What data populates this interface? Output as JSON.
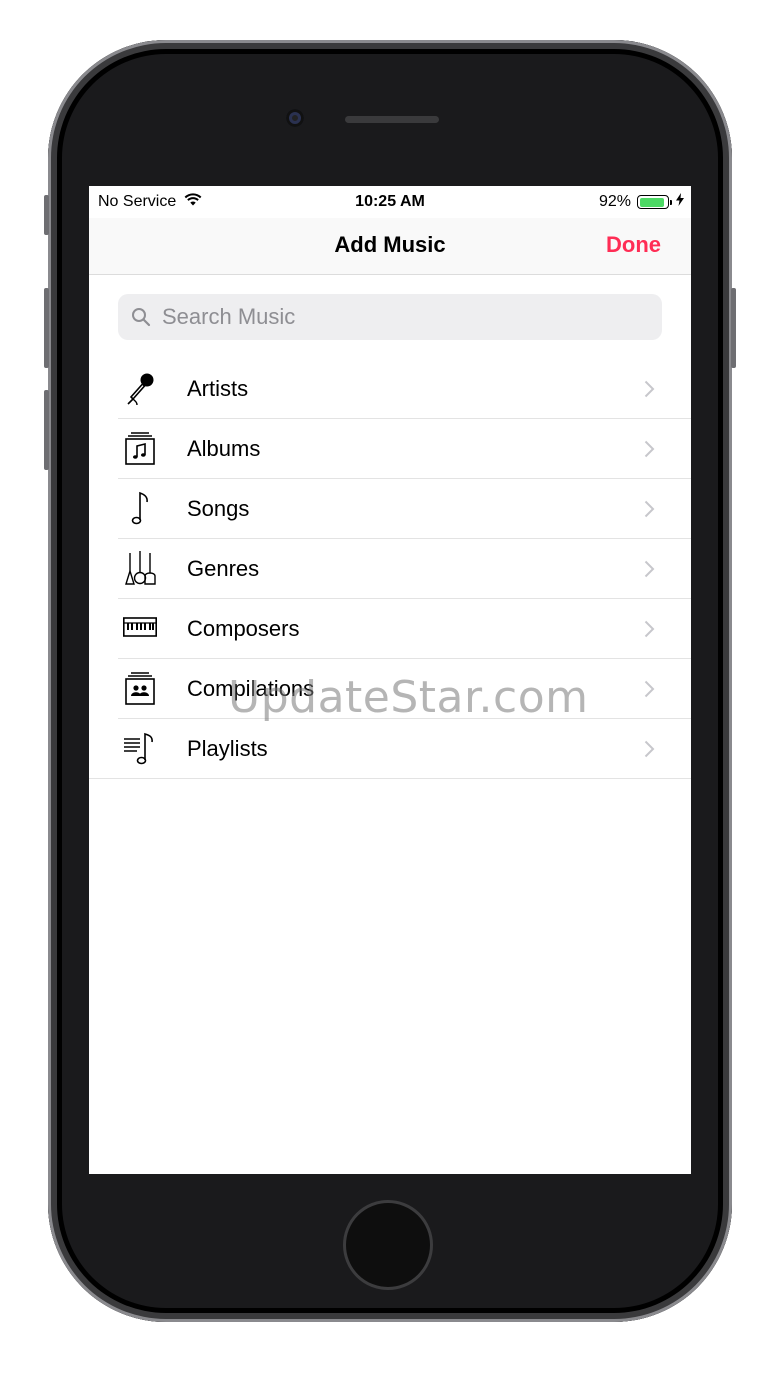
{
  "status_bar": {
    "carrier": "No Service",
    "time": "10:25 AM",
    "battery_percent": "92%",
    "battery_level": 0.92,
    "battery_color": "#4cd964"
  },
  "navbar": {
    "title": "Add Music",
    "done_label": "Done",
    "done_color": "#ff2d55"
  },
  "search": {
    "placeholder": "Search Music",
    "icon": "search-icon"
  },
  "list": {
    "items": [
      {
        "label": "Artists",
        "icon": "microphone-icon"
      },
      {
        "label": "Albums",
        "icon": "album-icon"
      },
      {
        "label": "Songs",
        "icon": "music-note-icon"
      },
      {
        "label": "Genres",
        "icon": "guitars-icon"
      },
      {
        "label": "Composers",
        "icon": "piano-keyboard-icon"
      },
      {
        "label": "Compilations",
        "icon": "compilation-icon"
      },
      {
        "label": "Playlists",
        "icon": "playlist-icon"
      }
    ]
  },
  "watermark": "UpdateStar.com"
}
